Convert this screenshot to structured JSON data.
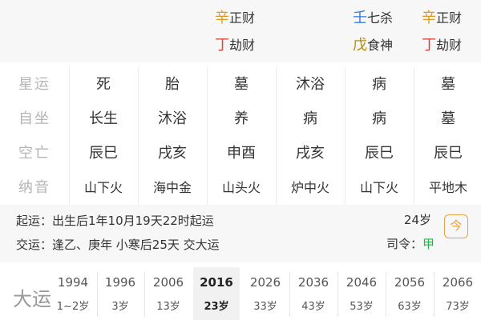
{
  "colors": {
    "gold": "#d89a2a",
    "red": "#d9473a",
    "blue": "#3a7bd5",
    "olive": "#b08a1a",
    "green": "#2bb24c",
    "label_gray": "#b5b5b5"
  },
  "hidden_stems": {
    "col2": [
      {
        "char": "辛",
        "god": "正财",
        "color": "#d89a2a"
      },
      {
        "char": "丁",
        "god": "劫财",
        "color": "#d9473a"
      }
    ],
    "col5": [
      {
        "char": "壬",
        "god": "七杀",
        "color": "#3a7bd5"
      },
      {
        "char": "戊",
        "god": "食神",
        "color": "#b08a1a"
      }
    ],
    "col6": [
      {
        "char": "辛",
        "god": "正财",
        "color": "#d89a2a"
      },
      {
        "char": "丁",
        "god": "劫财",
        "color": "#d9473a"
      }
    ]
  },
  "grid": {
    "rows": [
      {
        "label": "星运",
        "cells": [
          "死",
          "胎",
          "墓",
          "沐浴",
          "病",
          "墓"
        ]
      },
      {
        "label": "自坐",
        "cells": [
          "长生",
          "沐浴",
          "养",
          "病",
          "病",
          "墓"
        ]
      },
      {
        "label": "空亡",
        "cells": [
          "辰巳",
          "戌亥",
          "申酉",
          "戌亥",
          "辰巳",
          "辰巳"
        ]
      },
      {
        "label": "纳音",
        "cells": [
          "山下火",
          "海中金",
          "山头火",
          "炉中火",
          "山下火",
          "平地木"
        ]
      }
    ]
  },
  "info": {
    "qiyun": "起运：出生后1年10月19天22时起运",
    "jiaoyun": "交运：逢乙、庚年 小寒后25天 交大运",
    "age": "24岁",
    "siling_label": "司令：",
    "siling_value": "甲",
    "calendar_icon_char": "今"
  },
  "dayun": {
    "label": "大运",
    "periods": [
      {
        "year": "1994",
        "age": "1~2岁",
        "active": false
      },
      {
        "year": "1996",
        "age": "3岁",
        "active": false
      },
      {
        "year": "2006",
        "age": "13岁",
        "active": false
      },
      {
        "year": "2016",
        "age": "23岁",
        "active": true
      },
      {
        "year": "2026",
        "age": "33岁",
        "active": false
      },
      {
        "year": "2036",
        "age": "43岁",
        "active": false
      },
      {
        "year": "2046",
        "age": "53岁",
        "active": false
      },
      {
        "year": "2056",
        "age": "63岁",
        "active": false
      },
      {
        "year": "2066",
        "age": "73岁",
        "active": false
      }
    ]
  }
}
